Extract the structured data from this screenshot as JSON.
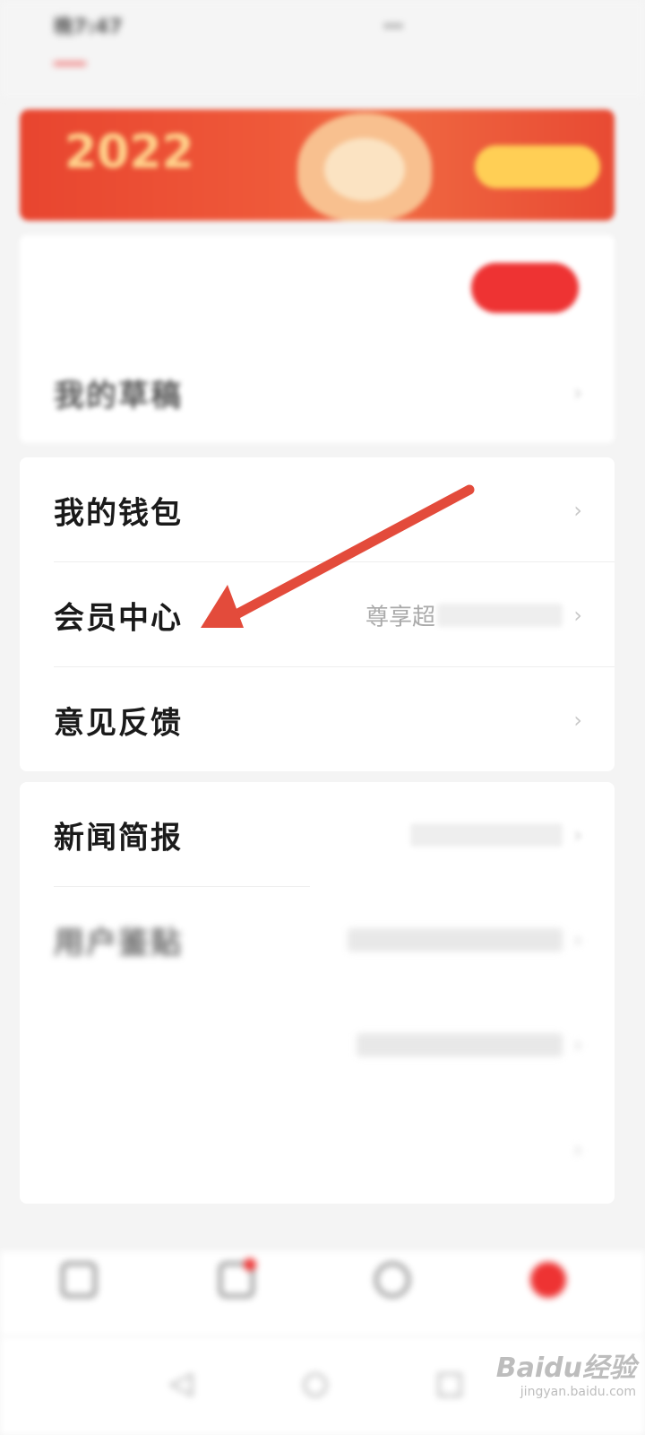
{
  "status": {
    "left": "晚7:47",
    "right": "…"
  },
  "tabs": [
    "",
    "",
    "",
    "",
    "",
    "",
    ""
  ],
  "banner": {
    "year": "2022",
    "subtitle": "",
    "button": ""
  },
  "card1": {
    "row1_label": "",
    "row1_pill": "",
    "row2_label": "我的草稿"
  },
  "card2": {
    "wallet_label": "我的钱包",
    "vip_label": "会员中心",
    "vip_value": "尊享超",
    "feedback_label": "意见反馈"
  },
  "card3": {
    "news_label": "新闻简报",
    "news_value": "",
    "row2_label": "用户鉴贴",
    "row2_value": "",
    "row3_label": "",
    "row3_value": "",
    "row4_label": ""
  },
  "bottom_nav": [
    "",
    "",
    "",
    ""
  ],
  "watermark": {
    "main": "Baidu经验",
    "sub": "jingyan.baidu.com"
  },
  "colors": {
    "accent": "#ee3322",
    "arrow": "#e34b3b",
    "banner": "#ef5a3a"
  }
}
